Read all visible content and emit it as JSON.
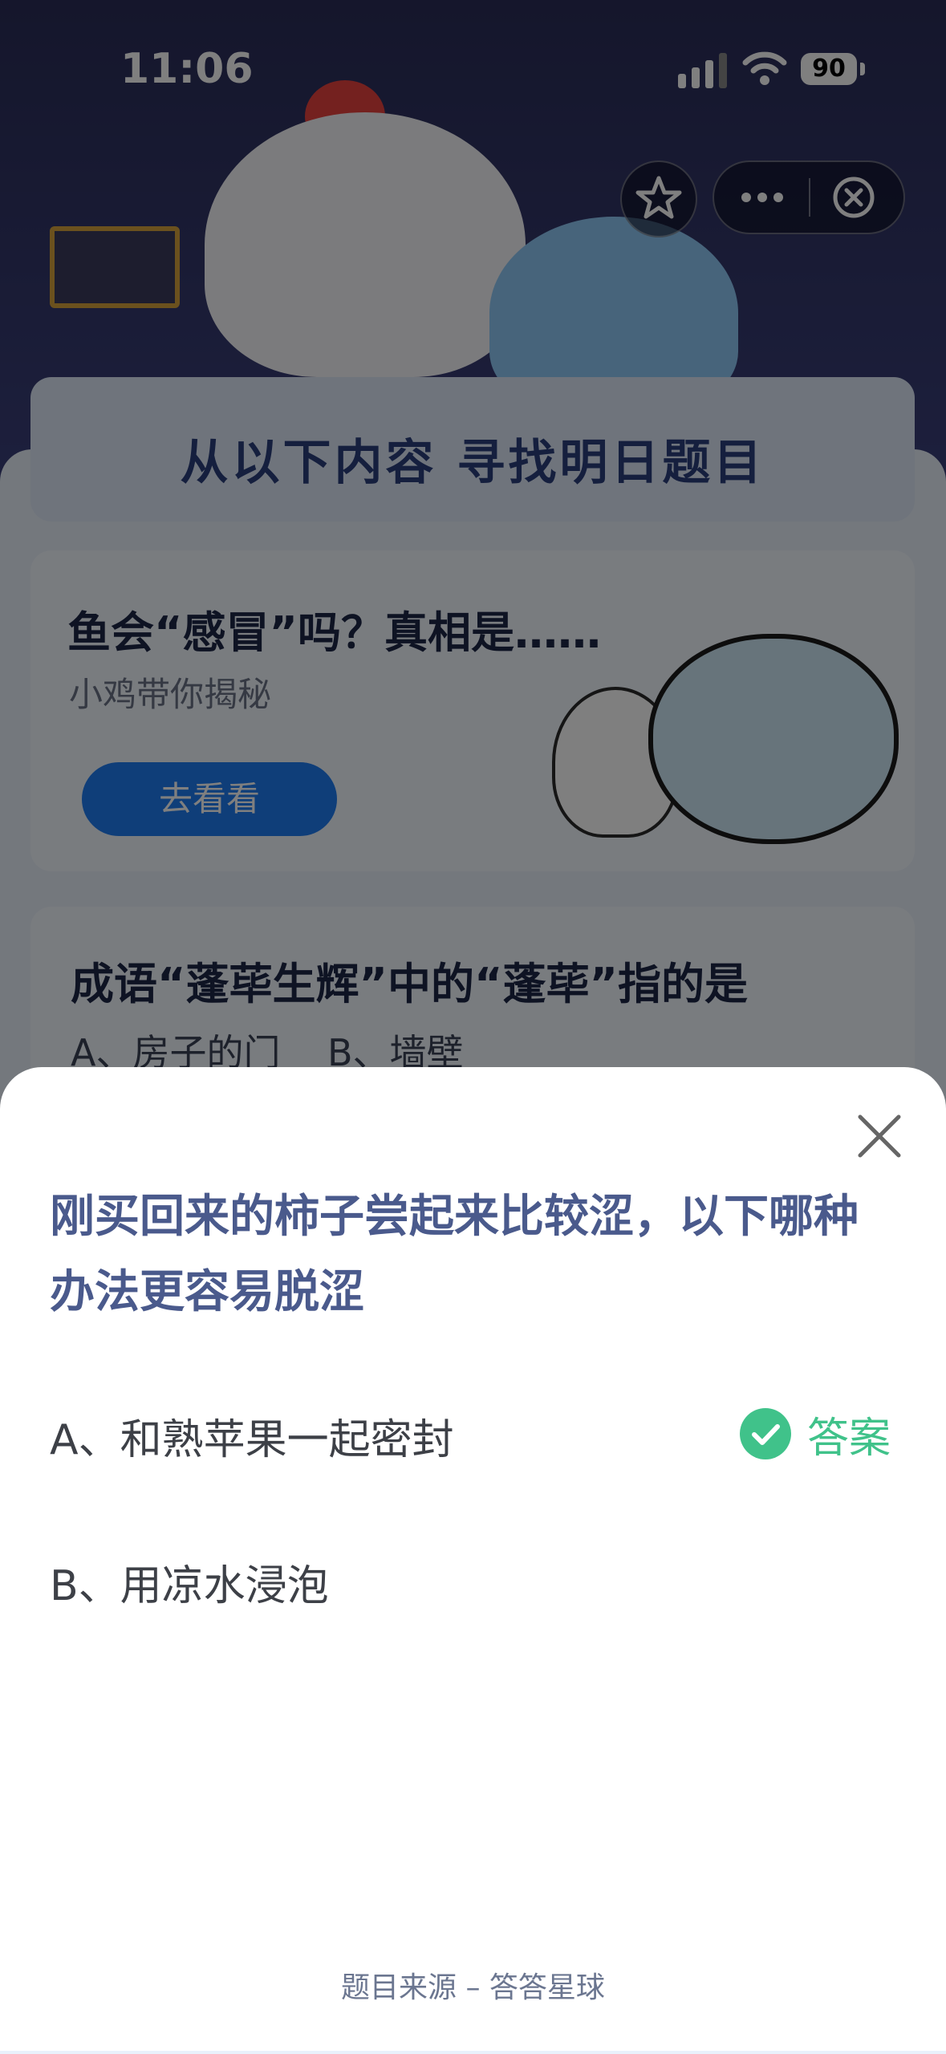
{
  "status_bar": {
    "time": "11:06",
    "battery": "90"
  },
  "background_page": {
    "headline": "从以下内容 寻找明日题目",
    "card1": {
      "title": "鱼会“感冒”吗？真相是……",
      "subtitle": "小鸡带你揭秘",
      "button": "去看看"
    },
    "card2": {
      "title": "成语“蓬荜生辉”中的“蓬荜”指的是",
      "options": "A、房子的门    B、墙壁"
    }
  },
  "sheet": {
    "question": "刚买回来的柿子尝起来比较涩，以下哪种办法更容易脱涩",
    "options": [
      {
        "label": "A、和熟苹果一起密封"
      },
      {
        "label": "B、用凉水浸泡"
      }
    ],
    "answer_label": "答案",
    "source": "题目来源 – 答答星球"
  },
  "colors": {
    "accent_green": "#40c28a",
    "question_blue": "#4a5a8c"
  },
  "icons": [
    "star-icon",
    "more-icon",
    "close-circle-icon",
    "close-icon",
    "check-icon"
  ]
}
